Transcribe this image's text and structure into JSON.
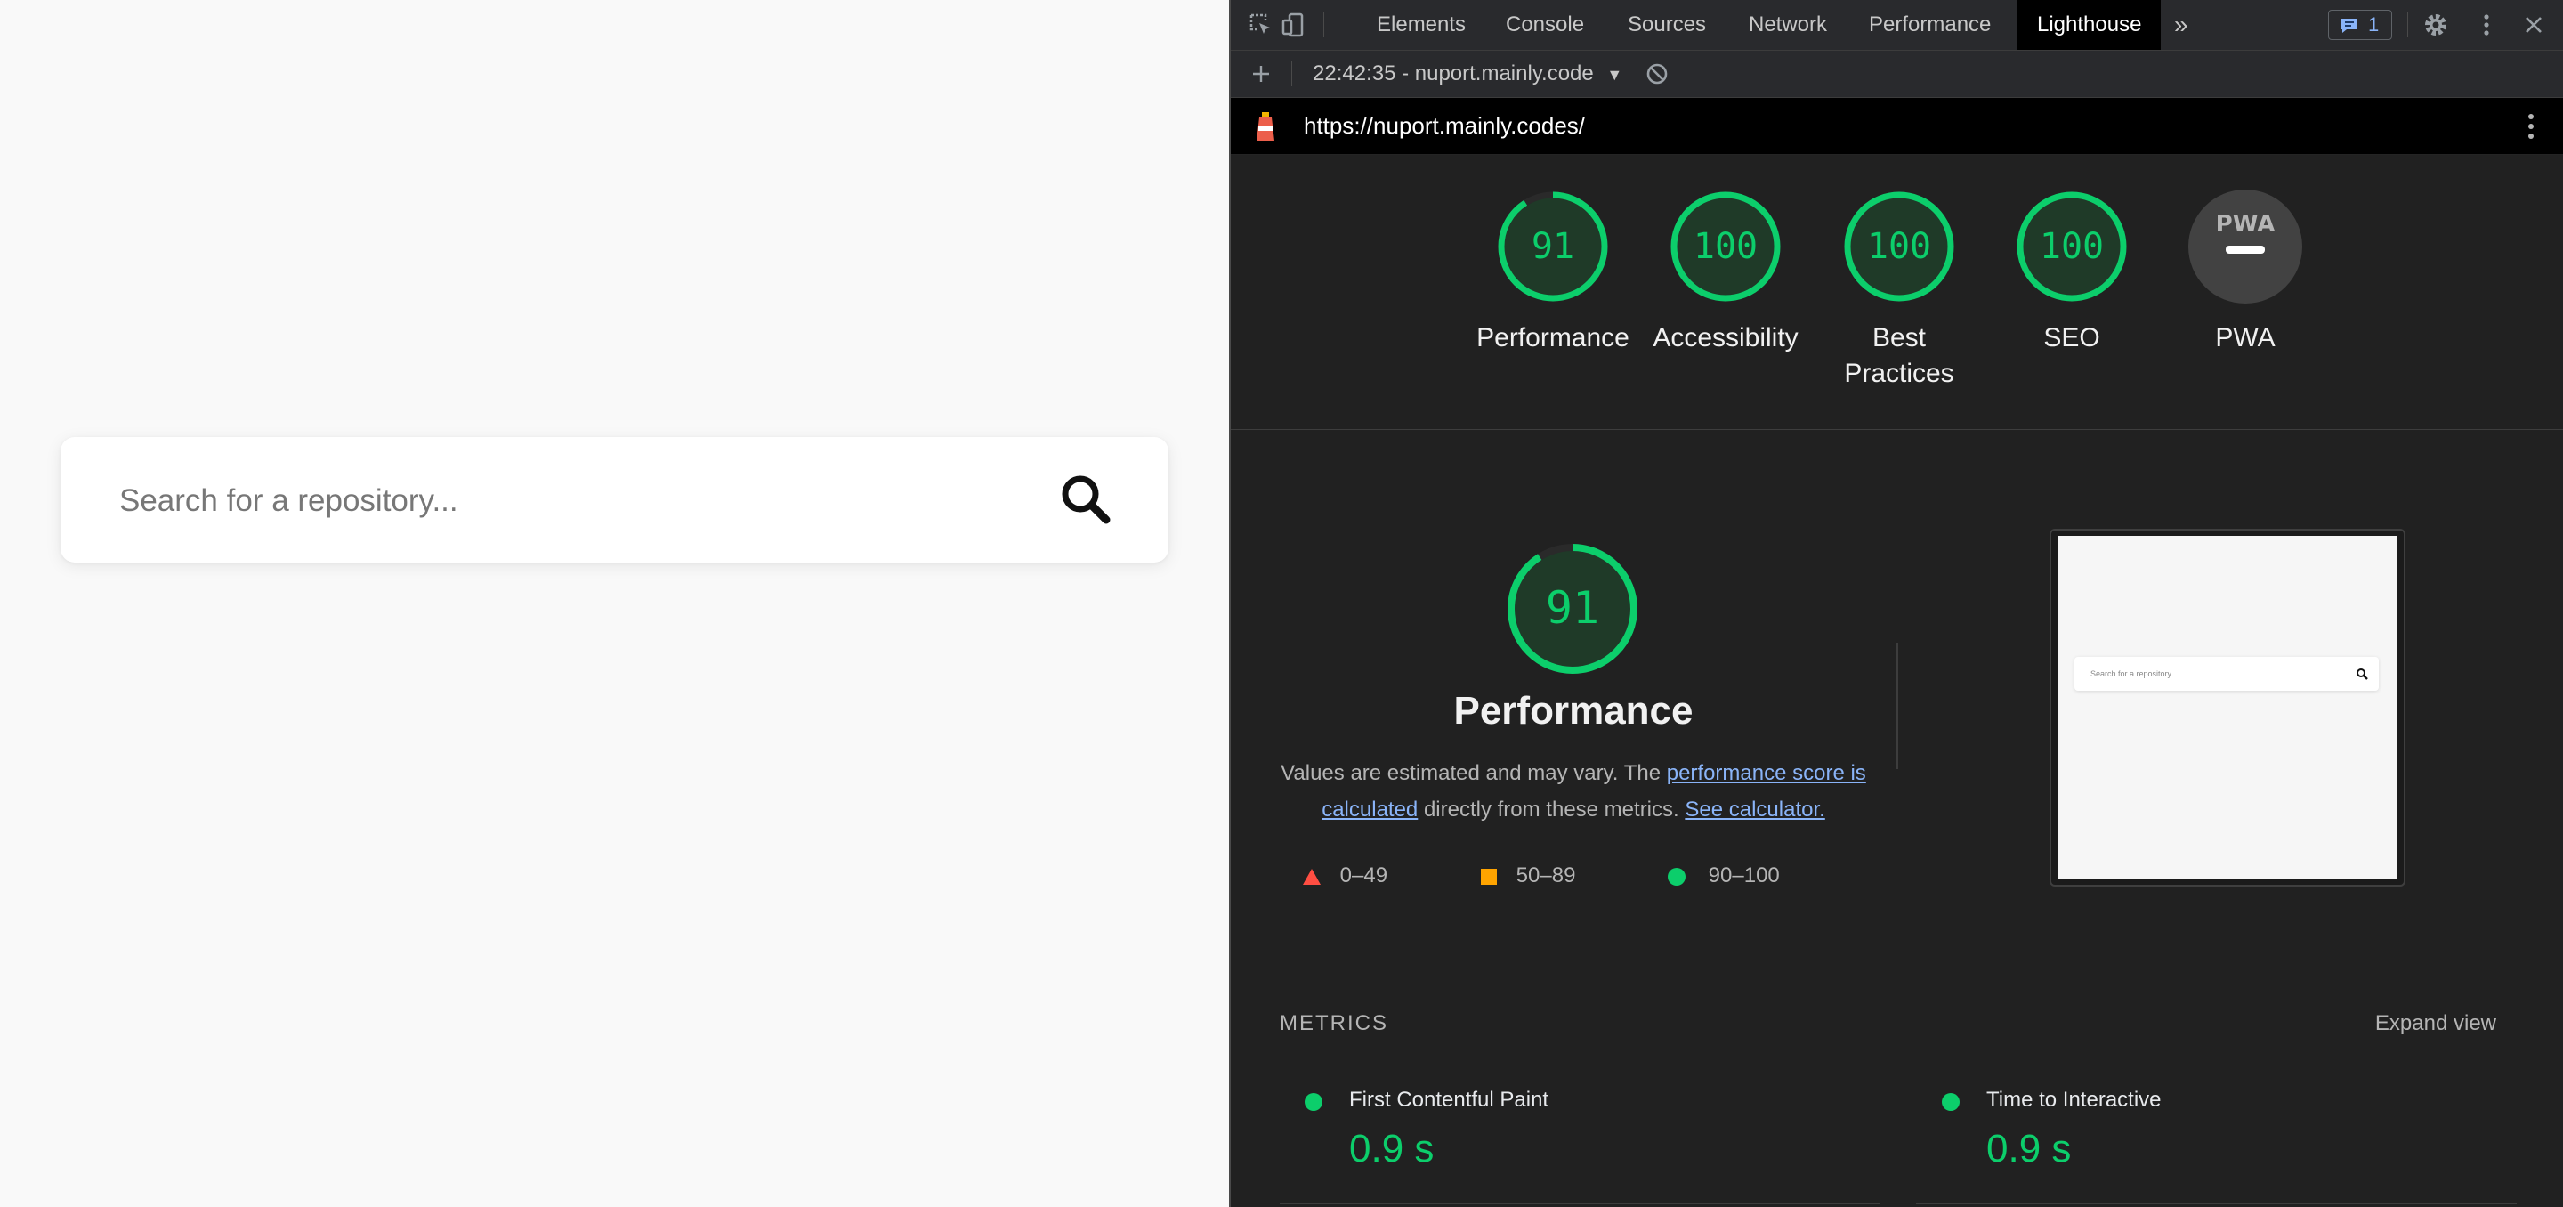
{
  "page": {
    "search": {
      "placeholder": "Search for a repository..."
    }
  },
  "devtools": {
    "tabs": [
      "Elements",
      "Console",
      "Sources",
      "Network",
      "Performance",
      "Lighthouse"
    ],
    "active_tab": "Lighthouse",
    "issues_count": "1",
    "report_selector": "22:42:35 - nuport.mainly.code",
    "report_url": "https://nuport.mainly.codes/",
    "colors": {
      "pass": "#0cce6b",
      "average": "#ffa400",
      "fail": "#ff4e42",
      "pwa_bg": "#424242"
    }
  },
  "scores": [
    {
      "label": "Performance",
      "value": "91",
      "fraction": 0.91
    },
    {
      "label": "Accessibility",
      "value": "100",
      "fraction": 1.0
    },
    {
      "label": "Best Practices",
      "value": "100",
      "fraction": 1.0
    },
    {
      "label": "SEO",
      "value": "100",
      "fraction": 1.0
    },
    {
      "label": "PWA",
      "value": "PWA",
      "fraction": null
    }
  ],
  "performance": {
    "score": "91",
    "fraction": 0.91,
    "title": "Performance",
    "desc_part1": "Values are estimated and may vary. The ",
    "desc_link1": "performance score is calculated",
    "desc_part2": " directly from these metrics. ",
    "desc_link2": "See calculator.",
    "legend": [
      "0–49",
      "50–89",
      "90–100"
    ],
    "screenshot_placeholder": "Search for a repository..."
  },
  "metrics": {
    "header": "METRICS",
    "expand": "Expand view",
    "items": [
      {
        "name": "First Contentful Paint",
        "value": "0.9 s"
      },
      {
        "name": "Time to Interactive",
        "value": "0.9 s"
      }
    ]
  }
}
